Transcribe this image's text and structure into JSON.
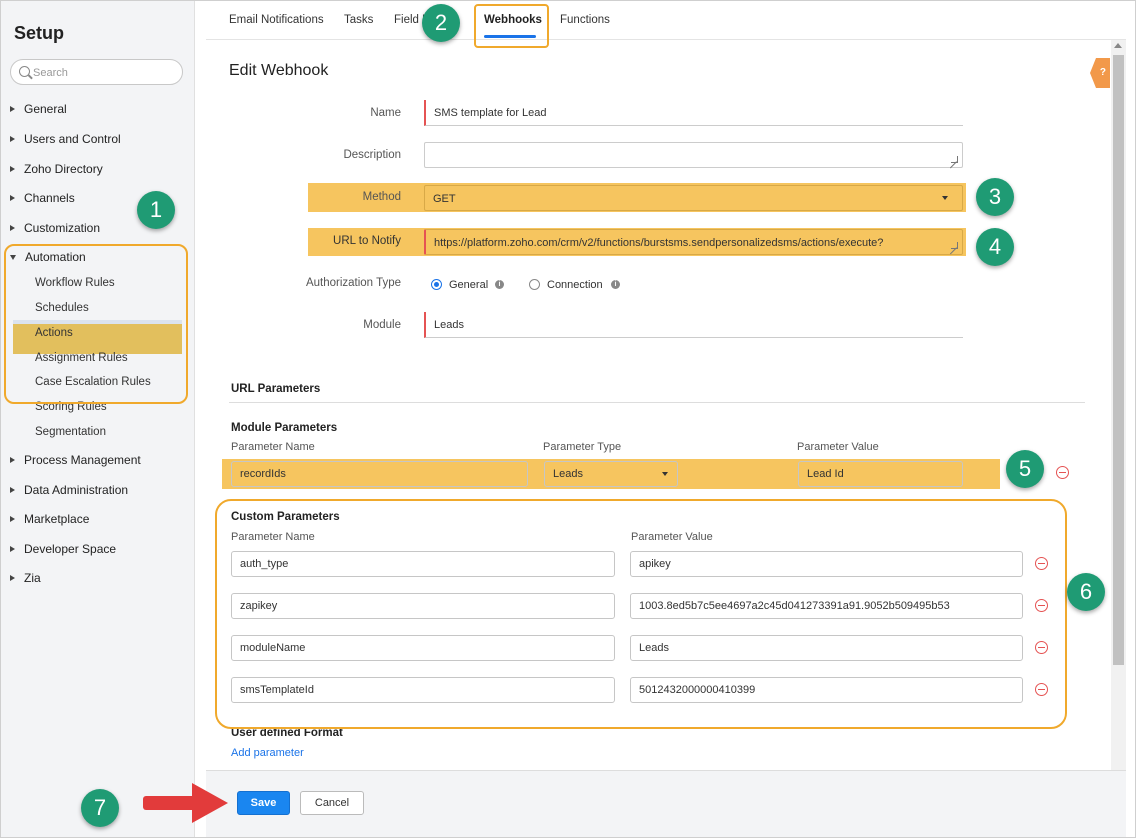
{
  "sidebar": {
    "title": "Setup",
    "search_placeholder": "Search",
    "items": [
      {
        "label": "General"
      },
      {
        "label": "Users and Control"
      },
      {
        "label": "Zoho Directory"
      },
      {
        "label": "Channels"
      },
      {
        "label": "Customization"
      },
      {
        "label": "Automation"
      },
      {
        "label": "Process Management"
      },
      {
        "label": "Data Administration"
      },
      {
        "label": "Marketplace"
      },
      {
        "label": "Developer Space"
      },
      {
        "label": "Zia"
      }
    ],
    "automation_subitems": [
      {
        "label": "Workflow Rules"
      },
      {
        "label": "Schedules"
      },
      {
        "label": "Actions"
      },
      {
        "label": "Assignment Rules"
      },
      {
        "label": "Case Escalation Rules"
      },
      {
        "label": "Scoring Rules"
      },
      {
        "label": "Segmentation"
      }
    ]
  },
  "tabs": [
    {
      "label": "Email Notifications"
    },
    {
      "label": "Tasks"
    },
    {
      "label": "Field U"
    },
    {
      "label": "Webhooks"
    },
    {
      "label": "Functions"
    }
  ],
  "form": {
    "title": "Edit Webhook",
    "name_label": "Name",
    "name_value": "SMS template for Lead",
    "description_label": "Description",
    "description_value": "",
    "method_label": "Method",
    "method_value": "GET",
    "url_label": "URL to Notify",
    "url_value": "https://platform.zoho.com/crm/v2/functions/burstsms.sendpersonalizedsms/actions/execute?",
    "auth_label": "Authorization Type",
    "auth_general": "General",
    "auth_connection": "Connection",
    "module_label": "Module",
    "module_value": "Leads"
  },
  "url_params": {
    "title": "URL Parameters",
    "module_params_title": "Module Parameters",
    "col_name": "Parameter Name",
    "col_type": "Parameter Type",
    "col_value": "Parameter Value",
    "module_row": {
      "name": "recordIds",
      "type": "Leads",
      "value": "Lead Id"
    },
    "custom_title": "Custom Parameters",
    "custom_col_name": "Parameter Name",
    "custom_col_value": "Parameter Value",
    "custom_rows": [
      {
        "name": "auth_type",
        "value": "apikey"
      },
      {
        "name": "zapikey",
        "value": "1003.8ed5b7c5ee4697a2c45d041273391a91.9052b509495b53"
      },
      {
        "name": "moduleName",
        "value": "Leads"
      },
      {
        "name": "smsTemplateId",
        "value": "5012432000000410399"
      }
    ],
    "user_defined_title": "User defined Format",
    "add_parameter": "Add parameter"
  },
  "footer": {
    "save": "Save",
    "cancel": "Cancel"
  },
  "help_tab": "?",
  "annotations": [
    "1",
    "2",
    "3",
    "4",
    "5",
    "6",
    "7"
  ],
  "colors": {
    "highlight": "#f6c55f",
    "outline": "#f0a92c",
    "badge": "#1f9b74",
    "primary": "#1a86f0",
    "arrow": "#e23b3b"
  }
}
